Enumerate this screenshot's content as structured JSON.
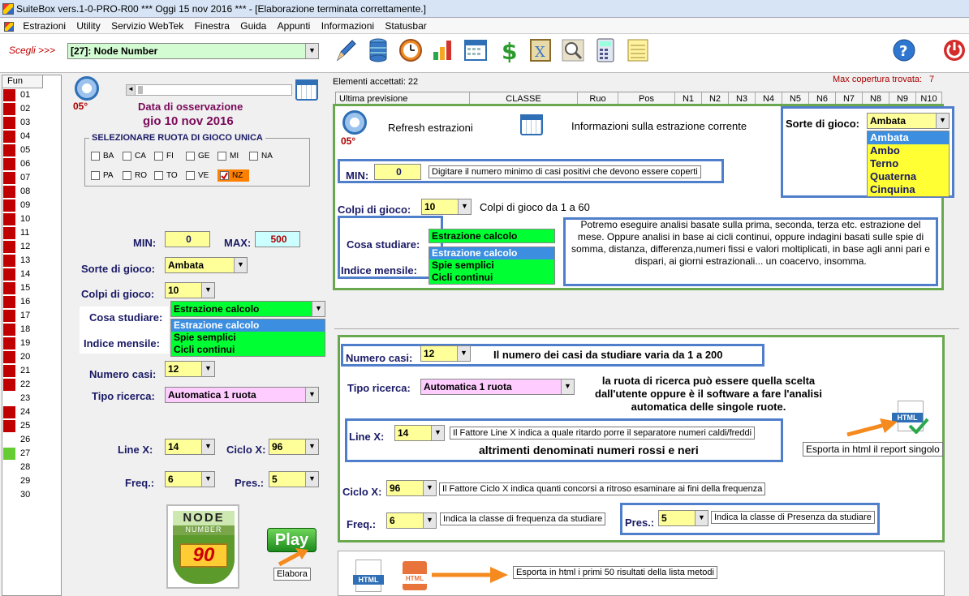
{
  "window": {
    "title": "SuiteBox vers.1-0-PRO-R00  ***  Oggi 15 nov 2016  ***   - [Elaborazione terminata correttamente.]"
  },
  "menu": [
    "Estrazioni",
    "Utility",
    "Servizio WebTek",
    "Finestra",
    "Guida",
    "Appunti",
    "Informazioni",
    "Statusbar"
  ],
  "toolbar": {
    "scegli_label": "Scegli >>>",
    "selected": "[27]: Node Number",
    "icons": [
      "pen-icon",
      "database-icon",
      "clock-icon",
      "chart-icon",
      "calendar-icon",
      "dollar-icon",
      "book-icon",
      "magnifier-icon",
      "calculator-icon",
      "notepad-icon",
      "help-icon",
      "power-icon"
    ]
  },
  "fun": {
    "header": "Fun",
    "rows": [
      {
        "n": "01",
        "c": "#c00000"
      },
      {
        "n": "02",
        "c": "#c00000"
      },
      {
        "n": "03",
        "c": "#c00000"
      },
      {
        "n": "04",
        "c": "#c00000"
      },
      {
        "n": "05",
        "c": "#c00000"
      },
      {
        "n": "06",
        "c": "#c00000"
      },
      {
        "n": "07",
        "c": "#c00000"
      },
      {
        "n": "08",
        "c": "#c00000"
      },
      {
        "n": "09",
        "c": "#c00000"
      },
      {
        "n": "10",
        "c": "#c00000"
      },
      {
        "n": "11",
        "c": "#c00000"
      },
      {
        "n": "12",
        "c": "#c00000"
      },
      {
        "n": "13",
        "c": "#c00000"
      },
      {
        "n": "14",
        "c": "#c00000"
      },
      {
        "n": "15",
        "c": "#c00000"
      },
      {
        "n": "16",
        "c": "#c00000"
      },
      {
        "n": "17",
        "c": "#c00000"
      },
      {
        "n": "18",
        "c": "#c00000"
      },
      {
        "n": "19",
        "c": "#c00000"
      },
      {
        "n": "20",
        "c": "#c00000"
      },
      {
        "n": "21",
        "c": "#c00000"
      },
      {
        "n": "22",
        "c": "#c00000"
      },
      {
        "n": "23",
        "c": ""
      },
      {
        "n": "24",
        "c": "#c00000"
      },
      {
        "n": "25",
        "c": "#c00000"
      },
      {
        "n": "26",
        "c": ""
      },
      {
        "n": "27",
        "c": "#66cc33"
      },
      {
        "n": "28",
        "c": ""
      },
      {
        "n": "29",
        "c": ""
      },
      {
        "n": "30",
        "c": ""
      }
    ]
  },
  "left": {
    "gear_caption": "05°",
    "obs_label": "Data di osservazione",
    "obs_date": "gio 10 nov 2016",
    "ruota_title": "SELEZIONARE RUOTA DI GIOCO UNICA",
    "ruote_row1": [
      "BA",
      "CA",
      "FI",
      "GE",
      "MI",
      "NA"
    ],
    "ruote_row2": [
      "PA",
      "RO",
      "TO",
      "VE",
      "NZ"
    ],
    "min_label": "MIN:",
    "min": "0",
    "max_label": "MAX:",
    "max": "500",
    "sorte_label": "Sorte di gioco:",
    "sorte": "Ambata",
    "colpi_label": "Colpi di gioco:",
    "colpi": "10",
    "cosa_label": "Cosa studiare:",
    "cosa": "Estrazione calcolo",
    "indice_label": "Indice mensile:",
    "cosa_options": [
      "Estrazione calcolo",
      "Spie semplici",
      "Cicli continui"
    ],
    "numcasi_label": "Numero casi:",
    "numcasi": "12",
    "tipo_label": "Tipo ricerca:",
    "tipo": "Automatica 1 ruota",
    "linex_label": "Line X:",
    "linex": "14",
    "ciclox_label": "Ciclo X:",
    "ciclox": "96",
    "freq_label": "Freq.:",
    "freq": "6",
    "pres_label": "Pres.:",
    "pres": "5",
    "logo_top": "NODE",
    "logo_mid": "NUMBER",
    "logo_num": "90",
    "play": "Play",
    "elabora": "Elabora"
  },
  "right": {
    "accepted": "Elementi accettati: 22",
    "maxcop": "Max copertura trovata:",
    "maxcop_val": "7",
    "headers": [
      "Ultima previsione",
      "CLASSE",
      "Ruo",
      "Pos",
      "N1",
      "N2",
      "N3",
      "N4",
      "N5",
      "N6",
      "N7",
      "N8",
      "N9",
      "N10"
    ],
    "refresh": "Refresh estrazioni",
    "info": "Informazioni sulla estrazione corrente",
    "gear_caption": "05°",
    "sorte_label": "Sorte di gioco:",
    "sorte": "Ambata",
    "sorte_options": [
      "Ambata",
      "Ambo",
      "Terno",
      "Quaterna",
      "Cinquina"
    ],
    "min_label": "MIN:",
    "min": "0",
    "min_note": "Digitare il numero minimo di casi positivi che devono essere coperti",
    "colpi_label": "Colpi di gioco:",
    "colpi": "10",
    "colpi_note": "Colpi di gioco da 1 a 60",
    "cosa_label": "Cosa studiare:",
    "indice_label": "Indice mensile:",
    "cosa": "Estrazione calcolo",
    "cosa_options": [
      "Estrazione calcolo",
      "Spie semplici",
      "Cicli continui"
    ],
    "cosa_note": "Potremo eseguire analisi basate sulla prima, seconda, terza etc. estrazione del mese. Oppure analisi in base ai cicli continui, oppure indagini basati sulle spie di somma, distanza, differenza,numeri fissi e valori moltiplicati, in base agli anni pari e dispari, ai giorni estrazionali... un coacervo, insomma.",
    "numcasi_label": "Numero casi:",
    "numcasi": "12",
    "numcasi_note": "Il numero dei casi da studiare varia da 1 a 200",
    "tipo_label": "Tipo ricerca:",
    "tipo": "Automatica 1 ruota",
    "tipo_note": "la ruota di ricerca può essere quella scelta dall'utente oppure è il software a fare l'analisi automatica delle singole ruote.",
    "linex_label": "Line X:",
    "linex": "14",
    "linex_note": "Il Fattore Line X indica a quale ritardo porre il separatore numeri caldi/freddi",
    "linex_note2": "altrimenti denominati numeri rossi e neri",
    "html_badge": "HTML",
    "export_single": "Esporta in html il report singolo",
    "ciclox_label": "Ciclo X:",
    "ciclox": "96",
    "ciclox_note": "Il Fattore Ciclo X indica quanti concorsi a ritroso esaminare ai fini della frequenza",
    "freq_label": "Freq.:",
    "freq": "6",
    "freq_note": "Indica la classe di frequenza da studiare",
    "pres_label": "Pres.:",
    "pres": "5",
    "pres_note": "Indica la classe di Presenza da studiare",
    "export_50": "Esporta in html i primi 50 risultati della lista metodi"
  },
  "colors": {
    "accent_green": "#6aa84f",
    "accent_blue": "#4f7ecb",
    "yellow_field": "#ffff99",
    "red_marker": "#c00000",
    "green_list": "#00ff33"
  }
}
